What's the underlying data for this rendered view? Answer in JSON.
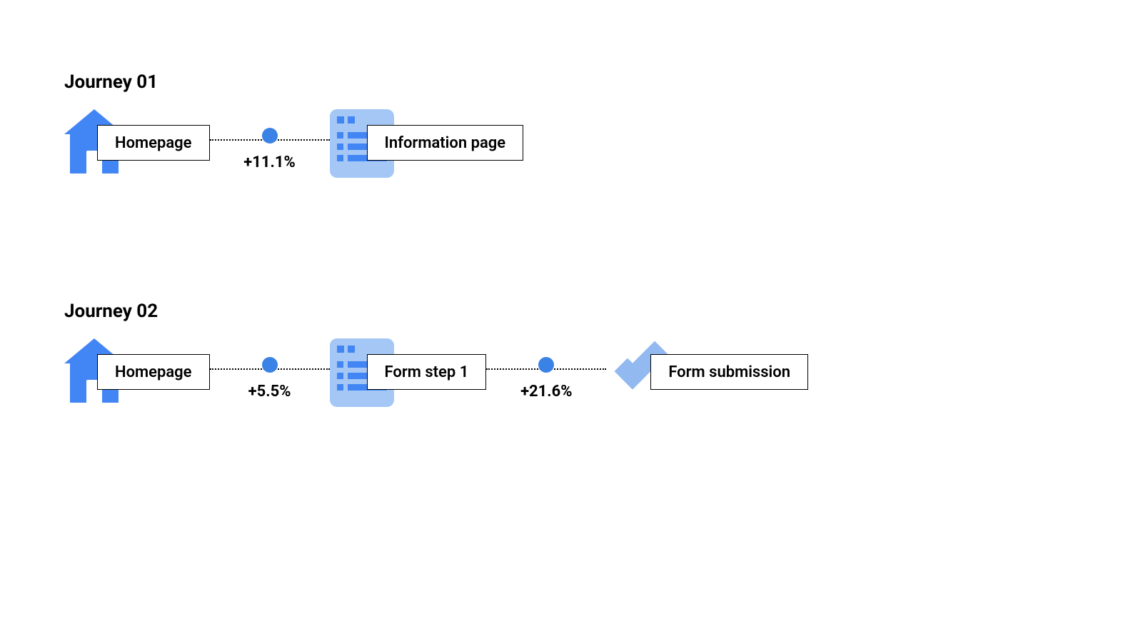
{
  "journeys": [
    {
      "title": "Journey 01",
      "steps": [
        {
          "icon": "house",
          "label": "Homepage"
        },
        {
          "icon": "page",
          "label": "Information page"
        }
      ],
      "connectors": [
        {
          "value": "+11.1%"
        }
      ]
    },
    {
      "title": "Journey 02",
      "steps": [
        {
          "icon": "house",
          "label": "Homepage"
        },
        {
          "icon": "page",
          "label": "Form step 1"
        },
        {
          "icon": "check",
          "label": "Form submission"
        }
      ],
      "connectors": [
        {
          "value": "+5.5%"
        },
        {
          "value": "+21.6%"
        }
      ]
    }
  ],
  "colors": {
    "primary_blue": "#4285f4",
    "light_blue": "#a4c7f5",
    "check_blue": "#92b9f0",
    "dot_blue": "#3b82e6"
  }
}
